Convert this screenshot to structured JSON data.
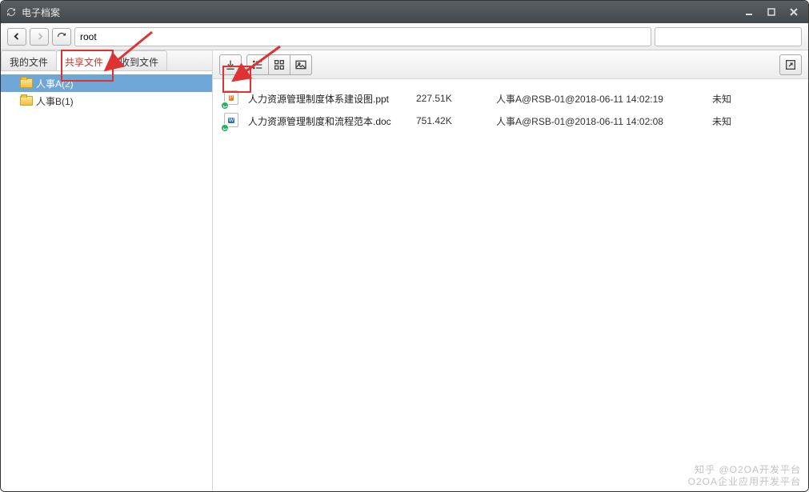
{
  "window": {
    "title": "电子档案"
  },
  "nav": {
    "path_value": "root"
  },
  "tabs": {
    "my_files": "我的文件",
    "shared_files": "共享文件",
    "received_files": "收到文件"
  },
  "sidebar": {
    "items": [
      {
        "label": "人事A(2)"
      },
      {
        "label": "人事B(1)"
      }
    ]
  },
  "files": [
    {
      "name": "人力资源管理制度体系建设图.ppt",
      "size": "227.51K",
      "meta": "人事A@RSB-01@2018-06-11 14:02:19",
      "status": "未知",
      "type": "ppt"
    },
    {
      "name": "人力资源管理制度和流程范本.doc",
      "size": "751.42K",
      "meta": "人事A@RSB-01@2018-06-11 14:02:08",
      "status": "未知",
      "type": "doc"
    }
  ],
  "watermark": {
    "line1": "知乎 @O2OA开发平台",
    "line2": "O2OA企业应用开发平台"
  }
}
